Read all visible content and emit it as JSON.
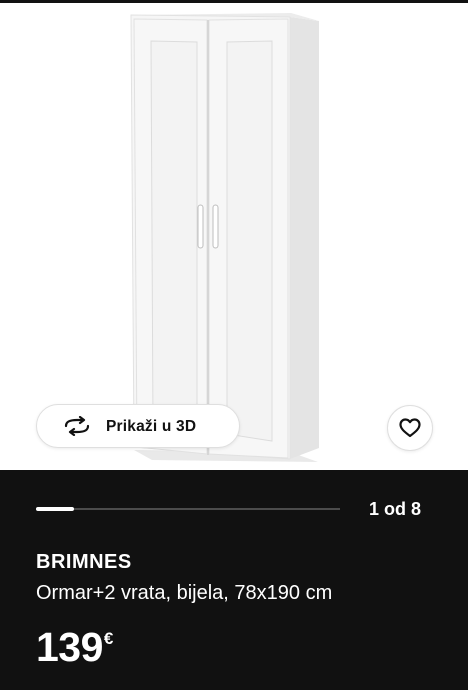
{
  "gallery": {
    "view_3d_label": "Prikaži u 3D",
    "view_3d_icon": "rotate-3d-icon",
    "favorite_icon": "heart-icon",
    "counter": "1 od 8",
    "progress": 0.125
  },
  "product": {
    "name": "BRIMNES",
    "description": "Ormar+2 vrata, bijela, 78x190 cm",
    "price": "139",
    "currency": "€"
  },
  "colors": {
    "background_dark": "#111111",
    "text_light": "#ffffff",
    "track": "#4c4c4c"
  }
}
